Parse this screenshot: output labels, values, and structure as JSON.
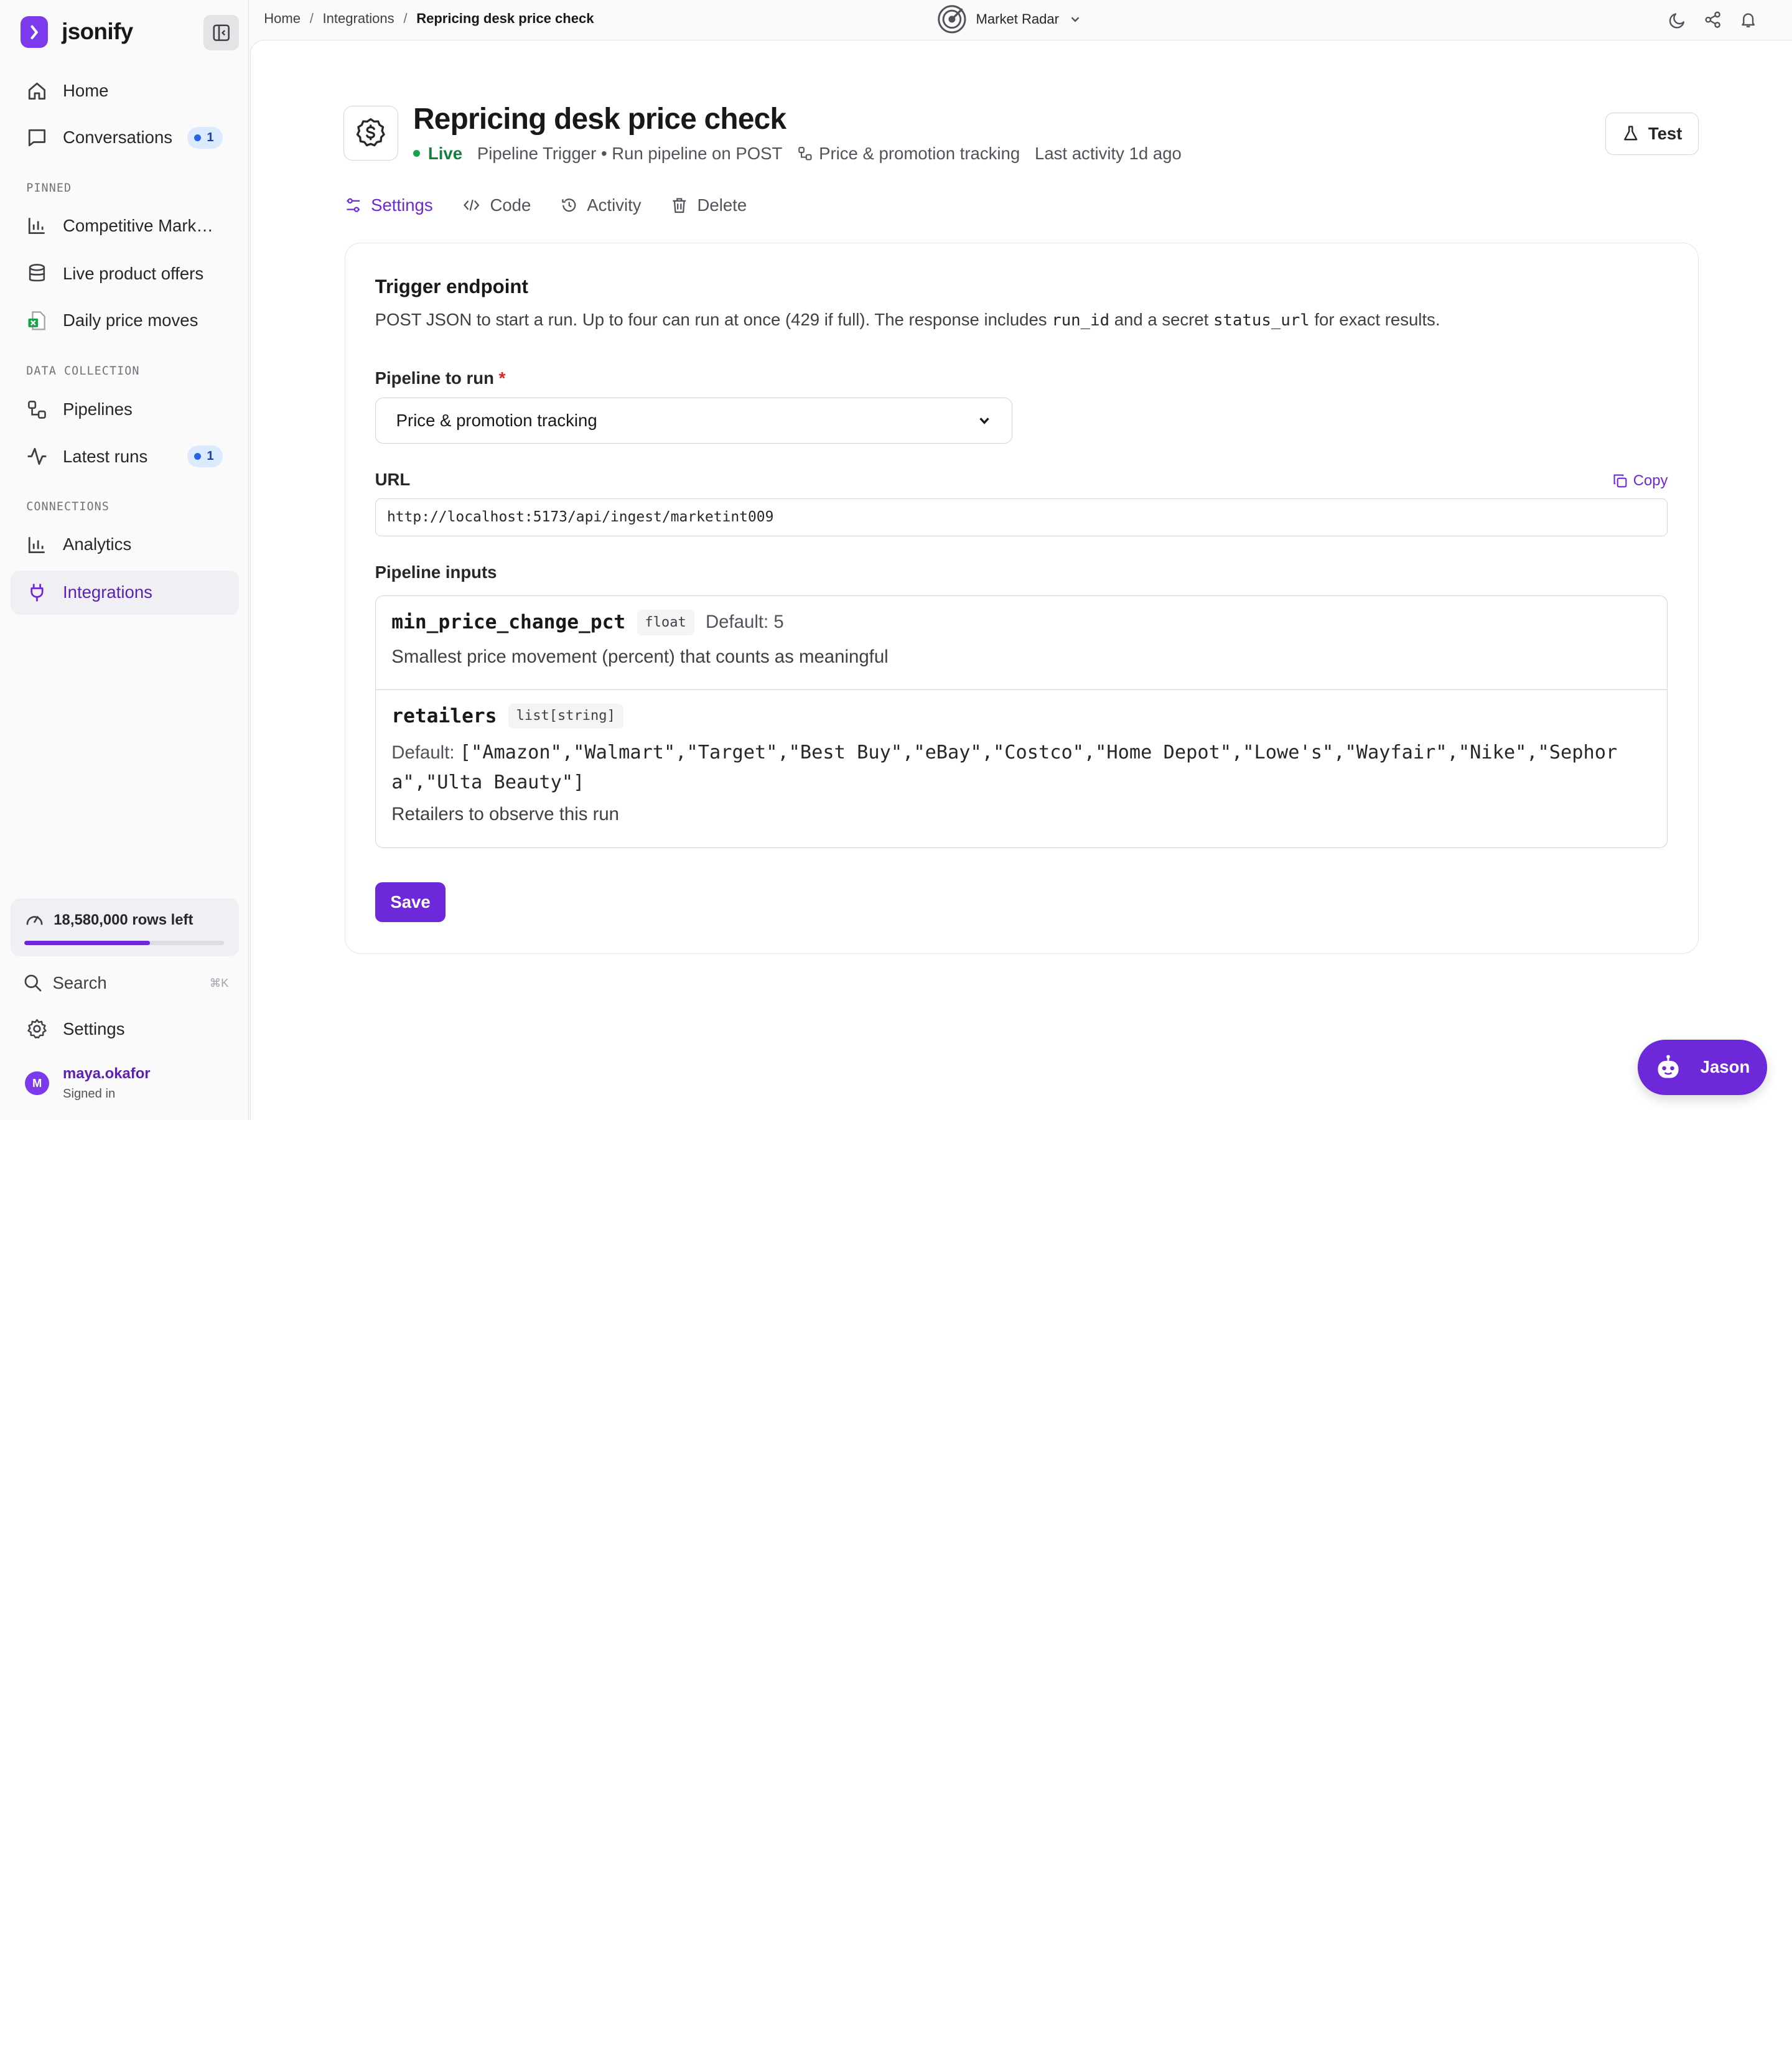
{
  "app": {
    "name": "jsonify"
  },
  "sidebar": {
    "nav_top": [
      {
        "label": "Home"
      },
      {
        "label": "Conversations",
        "badge": "1"
      }
    ],
    "pinned_label": "PINNED",
    "pinned": [
      {
        "label": "Competitive Market Intel"
      },
      {
        "label": "Live product offers"
      },
      {
        "label": "Daily price moves"
      }
    ],
    "data_collection_label": "DATA COLLECTION",
    "data_collection": [
      {
        "label": "Pipelines"
      },
      {
        "label": "Latest runs",
        "badge": "1"
      }
    ],
    "connections_label": "CONNECTIONS",
    "connections": [
      {
        "label": "Analytics"
      },
      {
        "label": "Integrations",
        "active": true
      }
    ],
    "usage": {
      "text": "18,580,000 rows left",
      "fraction": 0.63
    },
    "search": {
      "label": "Search",
      "shortcut": "⌘K"
    },
    "settings_label": "Settings",
    "user": {
      "initial": "M",
      "name": "maya.okafor",
      "status": "Signed in"
    }
  },
  "topbar": {
    "breadcrumbs": [
      "Home",
      "Integrations",
      "Repricing desk price check"
    ],
    "workspace": "Market Radar"
  },
  "header": {
    "title": "Repricing desk price check",
    "status": "Live",
    "trigger": "Pipeline Trigger • Run pipeline on POST",
    "project": "Price & promotion tracking",
    "last_activity": "Last activity 1d ago",
    "test_label": "Test"
  },
  "tabs": [
    {
      "label": "Settings",
      "active": true
    },
    {
      "label": "Code"
    },
    {
      "label": "Activity"
    },
    {
      "label": "Delete"
    }
  ],
  "card": {
    "title": "Trigger endpoint",
    "desc_1": "POST JSON to start a run. Up to four can run at once (429 if full). The response includes ",
    "desc_code_1": "run_id",
    "desc_2": " and a secret ",
    "desc_code_2": "status_url",
    "desc_3": " for exact results.",
    "pipeline_label": "Pipeline to run",
    "pipeline_required": "*",
    "pipeline_value": "Price & promotion tracking",
    "url_label": "URL",
    "copy_label": "Copy",
    "url_value": "http://localhost:5173/api/ingest/marketint009",
    "inputs_label": "Pipeline inputs",
    "inputs": [
      {
        "name": "min_price_change_pct",
        "type": "float",
        "default_label": "Default:",
        "default_value": "5",
        "description": "Smallest price movement (percent) that counts as meaningful"
      },
      {
        "name": "retailers",
        "type": "list[string]",
        "default_label": "Default:",
        "default_value": "[\"Amazon\",\"Walmart\",\"Target\",\"Best Buy\",\"eBay\",\"Costco\",\"Home Depot\",\"Lowe's\",\"Wayfair\",\"Nike\",\"Sephora\",\"Ulta Beauty\"]",
        "description": "Retailers to observe this run"
      }
    ],
    "save_label": "Save"
  },
  "assistant": {
    "label": "Jason"
  },
  "colors": {
    "accent": "#6d28d9",
    "live": "#16a34a",
    "badge_bg": "#dbeafe"
  }
}
